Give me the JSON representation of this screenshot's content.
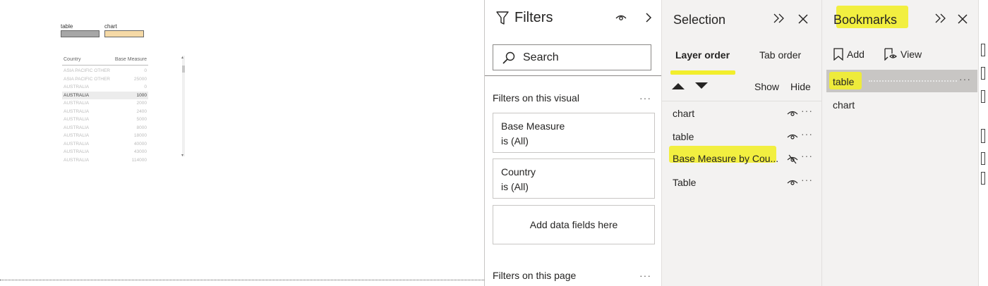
{
  "canvas": {
    "bookmark_buttons": [
      {
        "label": "table",
        "color": "#a6a6a6"
      },
      {
        "label": "chart",
        "color": "#f5d9a6"
      }
    ],
    "table": {
      "headers": {
        "country": "Country",
        "measure": "Base Measure"
      },
      "rows": [
        {
          "country": "ASIA PACIFIC OTHER",
          "measure": "0",
          "active": false
        },
        {
          "country": "ASIA PACIFIC OTHER",
          "measure": "25000",
          "active": false
        },
        {
          "country": "AUSTRALIA",
          "measure": "0",
          "active": false
        },
        {
          "country": "AUSTRALIA",
          "measure": "1000",
          "active": true
        },
        {
          "country": "AUSTRALIA",
          "measure": "2000",
          "active": false
        },
        {
          "country": "AUSTRALIA",
          "measure": "2400",
          "active": false
        },
        {
          "country": "AUSTRALIA",
          "measure": "5000",
          "active": false
        },
        {
          "country": "AUSTRALIA",
          "measure": "8000",
          "active": false
        },
        {
          "country": "AUSTRALIA",
          "measure": "18000",
          "active": false
        },
        {
          "country": "AUSTRALIA",
          "measure": "40000",
          "active": false
        },
        {
          "country": "AUSTRALIA",
          "measure": "43000",
          "active": false
        },
        {
          "country": "AUSTRALIA",
          "measure": "114000",
          "active": false
        }
      ]
    }
  },
  "filters": {
    "title": "Filters",
    "search_placeholder": "Search",
    "section_visual": "Filters on this visual",
    "section_page": "Filters on this page",
    "more": "···",
    "cards": [
      {
        "field": "Base Measure",
        "state": "is (All)"
      },
      {
        "field": "Country",
        "state": "is (All)"
      }
    ],
    "add_fields": "Add data fields here"
  },
  "selection": {
    "title": "Selection",
    "tabs": [
      "Layer order",
      "Tab order"
    ],
    "show": "Show",
    "hide": "Hide",
    "items": [
      {
        "label": "chart",
        "hidden": false,
        "active": false
      },
      {
        "label": "table",
        "hidden": false,
        "active": false
      },
      {
        "label": "Base Measure by Cou...",
        "hidden": true,
        "active": true
      },
      {
        "label": "Table",
        "hidden": false,
        "active": false
      }
    ],
    "more": "···"
  },
  "bookmarks": {
    "title": "Bookmarks",
    "add": "Add",
    "view": "View",
    "items": [
      {
        "label": "table",
        "active": true
      },
      {
        "label": "chart",
        "active": false
      }
    ],
    "more": "···"
  },
  "colors": {
    "highlight": "#f2ee2c",
    "pane_bg": "#f3f2f1",
    "selected_row": "#c8c6c4"
  }
}
